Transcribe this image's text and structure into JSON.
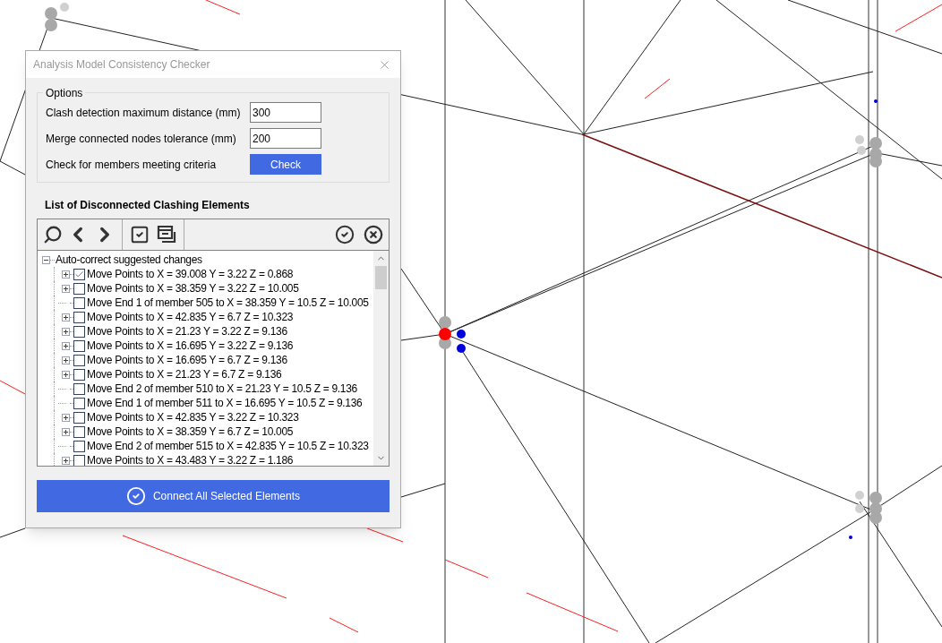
{
  "window": {
    "title": "Analysis Model Consistency Checker"
  },
  "options": {
    "title": "Options",
    "fields": [
      {
        "label": "Clash detection maximum distance (mm)",
        "value": "300"
      },
      {
        "label": "Merge connected nodes tolerance (mm)",
        "value": "200"
      }
    ],
    "check_label": "Check for members meeting criteria",
    "check_button": "Check"
  },
  "list": {
    "title": "List of Disconnected Clashing Elements",
    "tree": {
      "label": "Auto-correct suggested changes",
      "expanded": true,
      "children": [
        {
          "kind": "group",
          "checked": true,
          "label": "Move Points to X = 39.008  Y = 3.22 Z = 0.868"
        },
        {
          "kind": "group",
          "checked": false,
          "label": "Move Points to X = 38.359  Y = 3.22 Z = 10.005"
        },
        {
          "kind": "leaf",
          "checked": false,
          "label": "Move End 1 of member 505 to X = 38.359  Y = 10.5 Z = 10.005"
        },
        {
          "kind": "group",
          "checked": false,
          "label": "Move Points to X = 42.835  Y = 6.7 Z = 10.323"
        },
        {
          "kind": "group",
          "checked": false,
          "label": "Move Points to X = 21.23  Y = 3.22 Z = 9.136"
        },
        {
          "kind": "group",
          "checked": false,
          "label": "Move Points to X = 16.695  Y = 3.22 Z = 9.136"
        },
        {
          "kind": "group",
          "checked": false,
          "label": "Move Points to X = 16.695  Y = 6.7 Z = 9.136"
        },
        {
          "kind": "group",
          "checked": false,
          "label": "Move Points to X = 21.23  Y = 6.7 Z = 9.136"
        },
        {
          "kind": "leaf",
          "checked": false,
          "label": "Move End 2 of member 510 to X = 21.23  Y = 10.5 Z = 9.136"
        },
        {
          "kind": "leaf",
          "checked": false,
          "label": "Move End 1 of member 511 to X = 16.695  Y = 10.5 Z = 9.136"
        },
        {
          "kind": "group",
          "checked": false,
          "label": "Move Points to X = 42.835  Y = 3.22 Z = 10.323"
        },
        {
          "kind": "group",
          "checked": false,
          "label": "Move Points to X = 38.359  Y = 6.7 Z = 10.005"
        },
        {
          "kind": "leaf",
          "checked": false,
          "label": "Move End 2 of member 515 to X = 42.835  Y = 10.5 Z = 10.323"
        },
        {
          "kind": "group",
          "checked": false,
          "label": "Move Points to X = 43.483  Y = 3.22 Z = 1.186"
        }
      ]
    }
  },
  "connect_button": "Connect All Selected Elements"
}
